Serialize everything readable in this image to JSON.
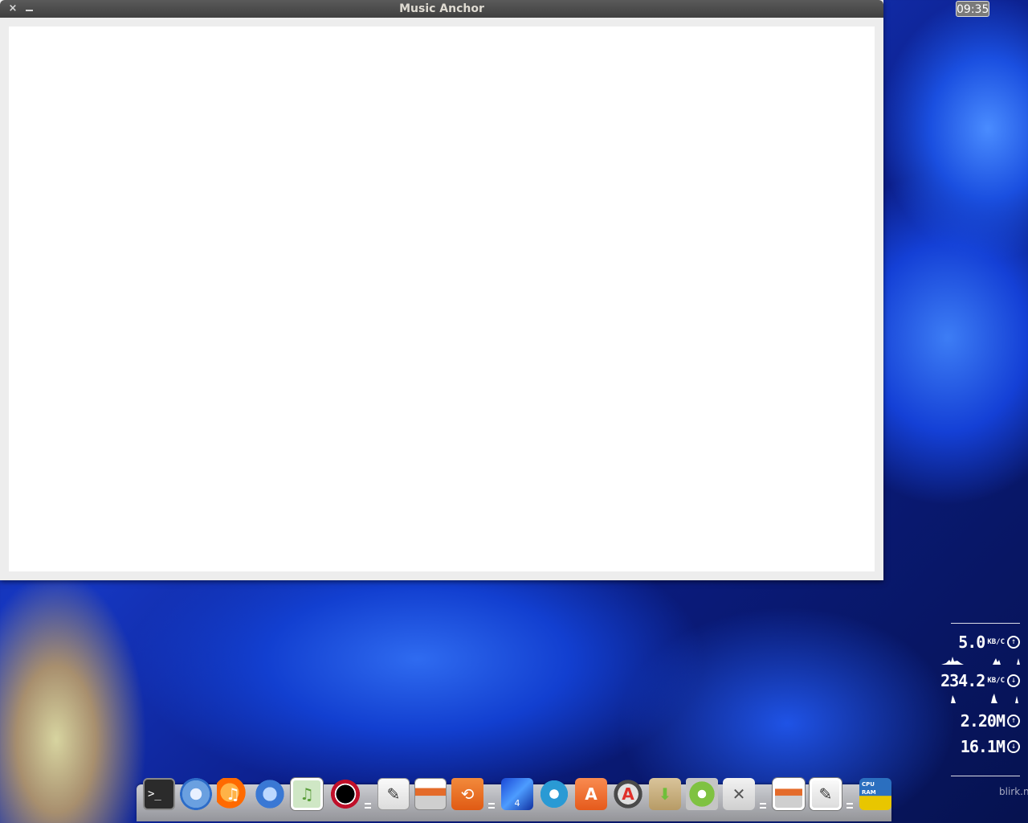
{
  "clock": {
    "time": "09:35"
  },
  "window": {
    "title": "Music Anchor",
    "close_icon": "×",
    "minimize_icon": "_"
  },
  "network_widget": {
    "upload_rate": "5.0",
    "upload_unit": "KB/C",
    "download_rate": "234.2",
    "download_unit": "KB/C",
    "upload_total": "2.20M",
    "download_total": "16.1M",
    "up_arrow": "↑",
    "down_arrow": "↓"
  },
  "desktop": {
    "brand_text": "blirk.n"
  },
  "dock": {
    "items": [
      {
        "name": "terminal",
        "glyph": ">_"
      },
      {
        "name": "chromium",
        "glyph": ""
      },
      {
        "name": "clementine",
        "glyph": "♫"
      },
      {
        "name": "thunderbird",
        "glyph": ""
      },
      {
        "name": "music",
        "glyph": "♫"
      },
      {
        "name": "eclipse",
        "glyph": ""
      },
      {
        "name": "text-editor",
        "glyph": "✎"
      },
      {
        "name": "files",
        "glyph": ""
      },
      {
        "name": "backup",
        "glyph": "⟲"
      },
      {
        "name": "workspace",
        "glyph": "4"
      },
      {
        "name": "shotwell",
        "glyph": ""
      },
      {
        "name": "software-center",
        "glyph": "A"
      },
      {
        "name": "update-manager",
        "glyph": "A"
      },
      {
        "name": "archive-manager",
        "glyph": "⬇"
      },
      {
        "name": "system-settings",
        "glyph": ""
      },
      {
        "name": "tweak-tool",
        "glyph": "✕"
      },
      {
        "name": "files-running",
        "glyph": ""
      },
      {
        "name": "text-editor-running",
        "glyph": "✎"
      },
      {
        "name": "system-monitor",
        "cpu_label": "CPU",
        "ram_label": "RAM"
      }
    ]
  }
}
